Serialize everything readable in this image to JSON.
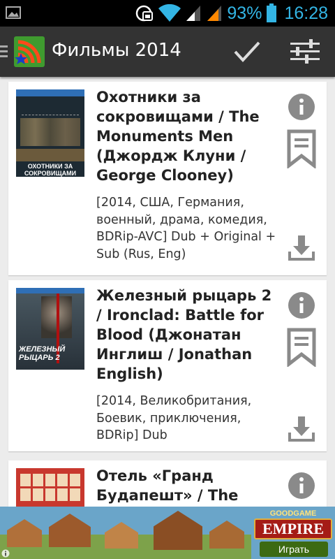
{
  "status_bar": {
    "battery_percent": "93%",
    "time": "16:28",
    "icons": [
      "gallery-icon",
      "screen-rotation-lock-icon",
      "wifi-icon",
      "signal-icon",
      "battery-icon"
    ]
  },
  "action_bar": {
    "title": "Фильмы 2014",
    "icons": [
      "up-icon",
      "app-logo-icon",
      "check-icon",
      "filter-sliders-icon"
    ]
  },
  "movies": [
    {
      "title": "Охотники за сокровищами / The Monuments Men (Джордж Клуни / George Clooney)",
      "meta": "[2014, США, Германия, военный, драма, комедия, BDRip-AVC] Dub + Original + Sub (Rus, Eng)",
      "poster_text": "ОХОТНИКИ ЗА СОКРОВИЩАМИ",
      "actions": [
        "info-icon",
        "bookmark-icon",
        "download-icon"
      ]
    },
    {
      "title": "Железный рыцарь 2 / Ironclad: Battle for Blood (Джонатан Инглиш / Jonathan English)",
      "meta": "[2014, Великобритания, Боевик, приключения, BDRip] Dub",
      "poster_text": "ЖЕЛЕЗНЫЙ РЫЦАРЬ 2",
      "actions": [
        "info-icon",
        "bookmark-icon",
        "download-icon"
      ]
    },
    {
      "title": "Отель «Гранд Будапешт» / The",
      "meta": "",
      "poster_text": "",
      "actions": [
        "info-icon"
      ]
    }
  ],
  "ad": {
    "logo_top": "GOODGAME",
    "logo_main": "EMPIRE",
    "play_button": "Играть"
  },
  "colors": {
    "status_accent": "#33b5e5",
    "action_bar": "#333333",
    "icon_grey": "#8a8a8a",
    "logo_green": "#3f9b2f",
    "ad_button": "#3c6a12"
  }
}
